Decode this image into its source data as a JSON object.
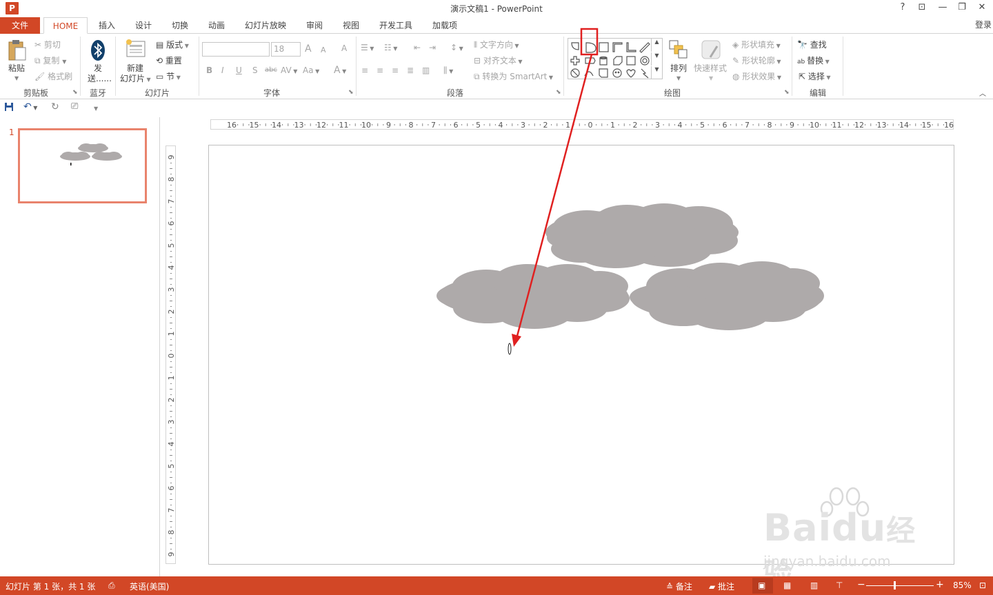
{
  "window": {
    "title": "演示文稿1 - PowerPoint",
    "logo_letter": "P",
    "help": "?",
    "ribbon_display": "⊡",
    "minimize": "—",
    "restore": "❐",
    "close": "✕"
  },
  "tabs": {
    "file": "文件",
    "items": [
      "HOME",
      "插入",
      "设计",
      "切换",
      "动画",
      "幻灯片放映",
      "审阅",
      "视图",
      "开发工具",
      "加载项"
    ],
    "active": "HOME",
    "login": "登录"
  },
  "ribbon": {
    "clipboard": {
      "label": "剪贴板",
      "paste": "粘贴",
      "cut": "剪切",
      "copy": "复制",
      "format_painter": "格式刷"
    },
    "bluetooth": {
      "label": "蓝牙",
      "send": "发",
      "send2": "送......"
    },
    "slides": {
      "label": "幻灯片",
      "new_slide": "新建",
      "new_slide2": "幻灯片",
      "layout": "版式",
      "reset": "重置",
      "section": "节"
    },
    "font": {
      "label": "字体",
      "font_name": "",
      "font_size": "18",
      "grow": "A",
      "shrink": "A",
      "clear": "A",
      "bold": "B",
      "italic": "I",
      "underline": "U",
      "shadow": "S",
      "strike": "abc",
      "spacing": "AV",
      "case": "Aa",
      "color": "A"
    },
    "paragraph": {
      "label": "段落",
      "text_direction": "文字方向",
      "align_text": "对齐文本",
      "smartart": "转换为 SmartArt"
    },
    "drawing": {
      "label": "绘图",
      "arrange": "排列",
      "quick_styles": "快速样式",
      "shape_fill": "形状填充",
      "shape_outline": "形状轮廓",
      "shape_effects": "形状效果"
    },
    "editing": {
      "label": "编辑",
      "find": "查找",
      "replace": "替换",
      "select": "选择"
    }
  },
  "ruler": {
    "h_labels": [
      "16",
      "15",
      "14",
      "13",
      "12",
      "11",
      "10",
      "9",
      "8",
      "7",
      "6",
      "5",
      "4",
      "3",
      "2",
      "1",
      "0",
      "1",
      "2",
      "3",
      "4",
      "5",
      "6",
      "7",
      "8",
      "9",
      "10",
      "11",
      "12",
      "13",
      "14",
      "15",
      "16"
    ],
    "v_labels": [
      "9",
      "8",
      "7",
      "6",
      "5",
      "4",
      "3",
      "2",
      "1",
      "0",
      "1",
      "2",
      "3",
      "4",
      "5",
      "6",
      "7",
      "8",
      "9"
    ]
  },
  "thumbnails": {
    "slide_number": "1"
  },
  "statusbar": {
    "slide_info": "幻灯片 第 1 张，共 1 张",
    "language": "英语(美国)",
    "notes": "备注",
    "comments": "批注",
    "zoom_minus": "−",
    "zoom_plus": "+",
    "zoom": "85%",
    "zoom_level": 0.85
  },
  "watermark": {
    "brand": "Bai",
    "brand2": "du",
    "brand_cn": "经验",
    "url": "jingyan.baidu.com"
  },
  "colors": {
    "accent": "#d24726",
    "cloud": "#aeaaaa",
    "annotation": "#e02020"
  }
}
